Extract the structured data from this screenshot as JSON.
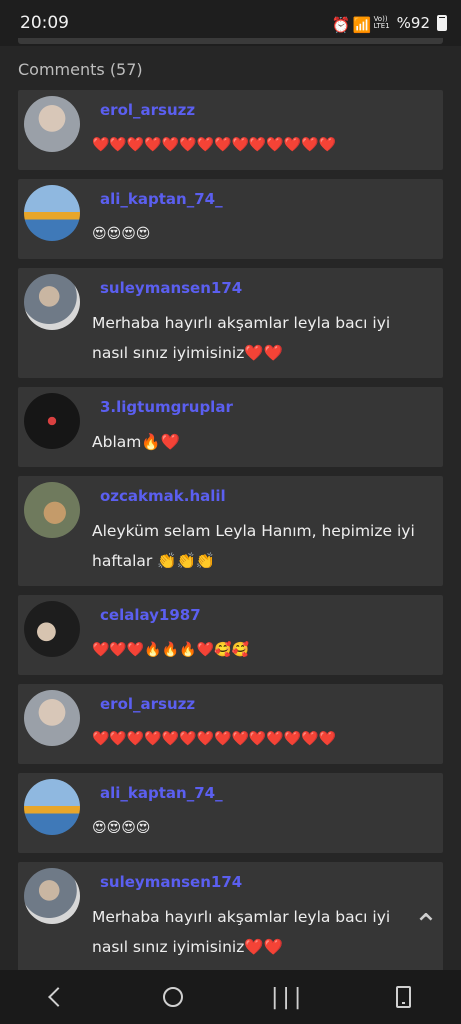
{
  "status_bar": {
    "time": "20:09",
    "signal": "Vo))",
    "network": "LTE1",
    "battery": "%92"
  },
  "comments_header": "Comments (57)",
  "comments": [
    {
      "username": "erol_arsuzz",
      "text": "❤️❤️❤️❤️❤️❤️❤️❤️❤️❤️❤️❤️❤️❤️",
      "avatar": "avatar-face"
    },
    {
      "username": "ali_kaptan_74_",
      "text": "😍😍😍😍",
      "avatar": "avatar-ship"
    },
    {
      "username": "suleymansen174",
      "text": "Merhaba hayırlı akşamlar leyla bacı iyi nasıl sınız iyimisiniz❤️❤️",
      "avatar": "avatar-man"
    },
    {
      "username": "3.ligtumgruplar",
      "text": "Ablam🔥❤️",
      "avatar": "avatar-logo"
    },
    {
      "username": "ozcakmak.halil",
      "text": "Aleyküm selam Leyla Hanım, hepimize iyi haftalar 👏👏👏",
      "avatar": "avatar-cat"
    },
    {
      "username": "celalay1987",
      "text": "❤️❤️❤️🔥🔥🔥❤️🥰🥰",
      "avatar": "avatar-dark"
    },
    {
      "username": "erol_arsuzz",
      "text": "❤️❤️❤️❤️❤️❤️❤️❤️❤️❤️❤️❤️❤️❤️",
      "avatar": "avatar-face"
    },
    {
      "username": "ali_kaptan_74_",
      "text": "😍😍😍😍",
      "avatar": "avatar-ship"
    },
    {
      "username": "suleymansen174",
      "text": "Merhaba hayırlı akşamlar leyla bacı iyi nasıl sınız iyimisiniz❤️❤️",
      "avatar": "avatar-man"
    }
  ],
  "icons": {
    "alarm": "alarm-icon",
    "wifi": "wifi-icon",
    "scroll_top": "chevron-up-icon",
    "nav_back": "back-icon",
    "nav_home": "home-icon",
    "nav_recent": "recent-apps-icon",
    "nav_phone": "phone-icon"
  },
  "colors": {
    "username": "#5b5ff0",
    "card": "#363636",
    "background": "#262626"
  }
}
